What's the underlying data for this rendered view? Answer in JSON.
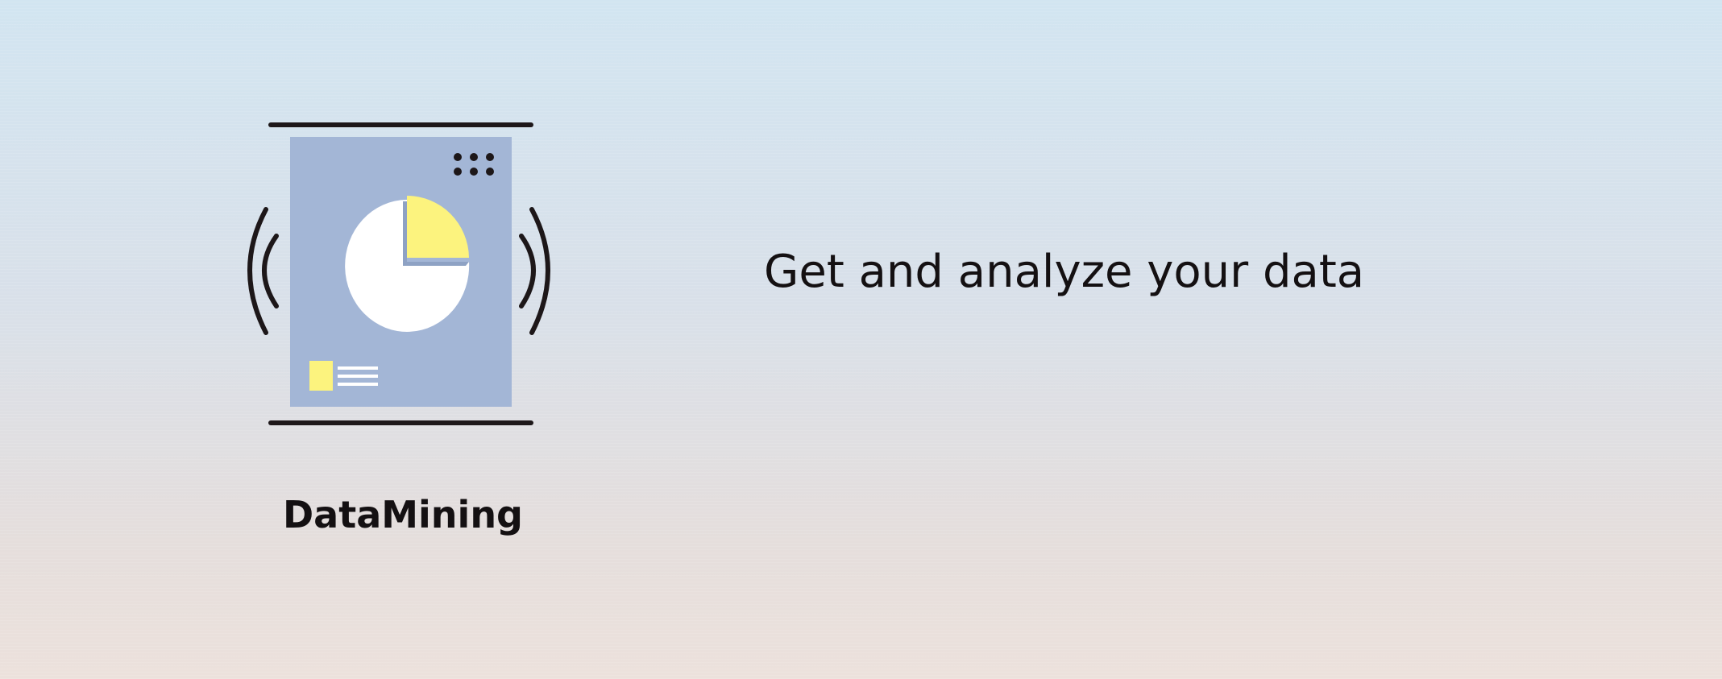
{
  "app": {
    "name": "DataMining",
    "tagline": "Get and analyze your data"
  },
  "illustration": {
    "icon": "data-analysis-icon",
    "panel_color": "#a3b6d6",
    "accent_color": "#fcf37e",
    "pie_color": "#ffffff",
    "line_color": "#1d1719",
    "pie_highlight_share": 0.25
  }
}
